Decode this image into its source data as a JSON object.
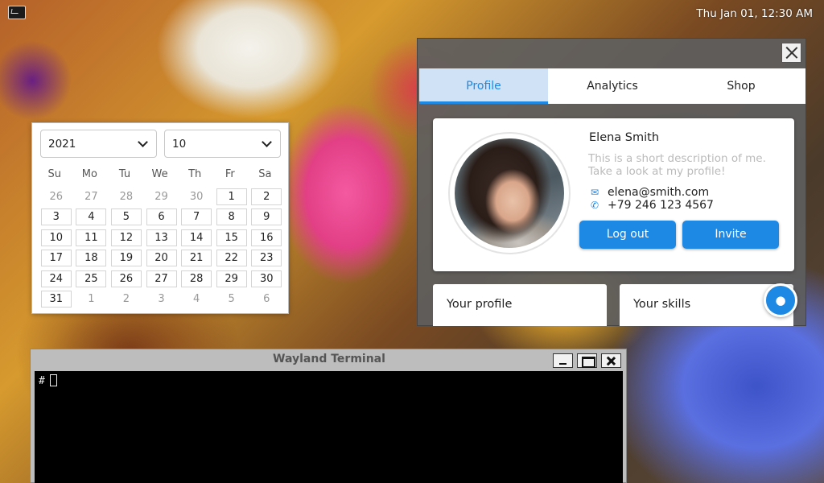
{
  "topbar": {
    "terminal_launcher_icon": "terminal-icon",
    "clock": "Thu Jan 01, 12:30 AM"
  },
  "calendar": {
    "year": "2021",
    "month": "10",
    "weekdays": [
      "Su",
      "Mo",
      "Tu",
      "We",
      "Th",
      "Fr",
      "Sa"
    ],
    "weeks": [
      [
        {
          "d": "26",
          "out": true
        },
        {
          "d": "27",
          "out": true
        },
        {
          "d": "28",
          "out": true
        },
        {
          "d": "29",
          "out": true
        },
        {
          "d": "30",
          "out": true
        },
        {
          "d": "1"
        },
        {
          "d": "2"
        }
      ],
      [
        {
          "d": "3"
        },
        {
          "d": "4"
        },
        {
          "d": "5"
        },
        {
          "d": "6"
        },
        {
          "d": "7"
        },
        {
          "d": "8"
        },
        {
          "d": "9"
        }
      ],
      [
        {
          "d": "10"
        },
        {
          "d": "11"
        },
        {
          "d": "12"
        },
        {
          "d": "13"
        },
        {
          "d": "14"
        },
        {
          "d": "15"
        },
        {
          "d": "16"
        }
      ],
      [
        {
          "d": "17"
        },
        {
          "d": "18"
        },
        {
          "d": "19"
        },
        {
          "d": "20"
        },
        {
          "d": "21"
        },
        {
          "d": "22"
        },
        {
          "d": "23"
        }
      ],
      [
        {
          "d": "24"
        },
        {
          "d": "25"
        },
        {
          "d": "26"
        },
        {
          "d": "27"
        },
        {
          "d": "28"
        },
        {
          "d": "29"
        },
        {
          "d": "30"
        }
      ],
      [
        {
          "d": "31"
        },
        {
          "d": "1",
          "out": true
        },
        {
          "d": "2",
          "out": true
        },
        {
          "d": "3",
          "out": true
        },
        {
          "d": "4",
          "out": true
        },
        {
          "d": "5",
          "out": true
        },
        {
          "d": "6",
          "out": true
        }
      ]
    ]
  },
  "profile_window": {
    "tabs": [
      {
        "label": "Profile",
        "active": true
      },
      {
        "label": "Analytics",
        "active": false
      },
      {
        "label": "Shop",
        "active": false
      }
    ],
    "card": {
      "name": "Elena Smith",
      "description": "This is a short description of me. Take a look at my profile!",
      "email": "elena@smith.com",
      "phone": "+79 246 123 4567",
      "logout_label": "Log out",
      "invite_label": "Invite"
    },
    "your_profile_label": "Your profile",
    "your_skills_label": "Your skills",
    "fab_icon": "droplet-icon",
    "accent_color": "#1e88e5"
  },
  "terminal": {
    "title": "Wayland Terminal",
    "prompt": "#"
  }
}
